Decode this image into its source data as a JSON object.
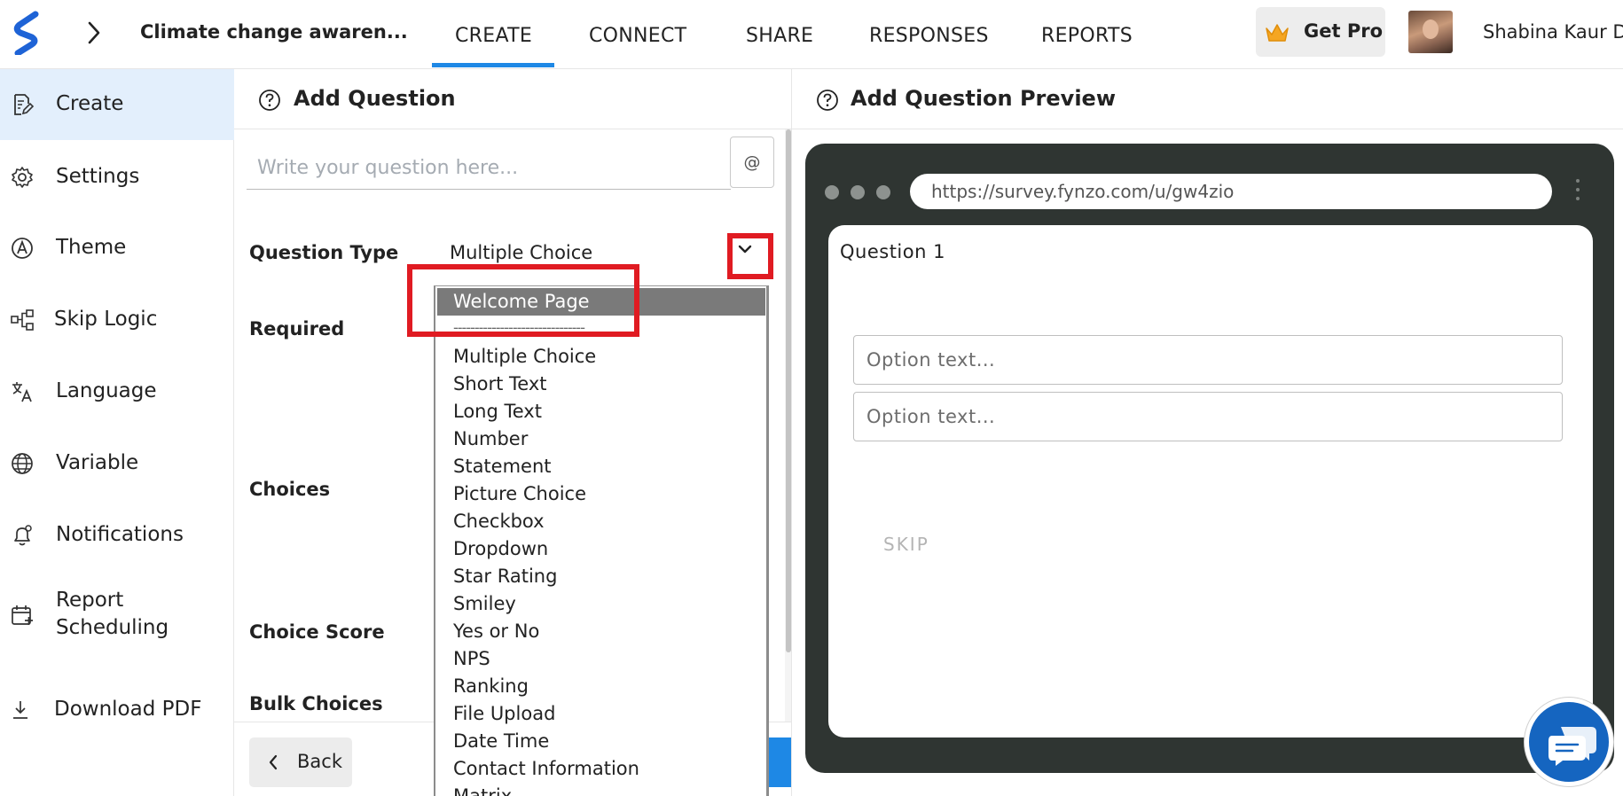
{
  "header": {
    "survey_title": "Climate change awaren...",
    "tabs": [
      {
        "label": "CREATE",
        "active": true
      },
      {
        "label": "CONNECT",
        "active": false
      },
      {
        "label": "SHARE",
        "active": false
      },
      {
        "label": "RESPONSES",
        "active": false
      },
      {
        "label": "REPORTS",
        "active": false
      }
    ],
    "get_pro_label": "Get Pro",
    "username": "Shabina Kaur D",
    "accent_color": "#1e88e5"
  },
  "sidebar": {
    "items": [
      {
        "label": "Create",
        "icon": "edit-document-icon",
        "active": true
      },
      {
        "label": "Settings",
        "icon": "gear-icon",
        "active": false
      },
      {
        "label": "Theme",
        "icon": "palette-icon",
        "active": false
      },
      {
        "label": "Skip Logic",
        "icon": "flow-icon",
        "active": false
      },
      {
        "label": "Language",
        "icon": "translate-icon",
        "active": false
      },
      {
        "label": "Variable",
        "icon": "globe-icon",
        "active": false
      },
      {
        "label": "Notifications",
        "icon": "bell-icon",
        "active": false
      },
      {
        "label": "Report",
        "label2": "Scheduling",
        "icon": "calendar-icon",
        "active": false
      },
      {
        "label": "Download PDF",
        "icon": "download-icon",
        "active": false
      }
    ]
  },
  "editor": {
    "title": "Add Question",
    "question_placeholder": "Write your question here...",
    "at_button": "@",
    "labels": {
      "question_type": "Question Type",
      "required": "Required",
      "choices": "Choices",
      "choice_score": "Choice Score",
      "bulk_choices": "Bulk Choices"
    },
    "question_type_value": "Multiple Choice",
    "back_label": "Back"
  },
  "dropdown": {
    "selected": "Welcome Page",
    "separator": "-------------------------------",
    "options": [
      "Multiple Choice",
      "Short Text",
      "Long Text",
      "Number",
      "Statement",
      "Picture Choice",
      "Checkbox",
      "Dropdown",
      "Star Rating",
      "Smiley",
      "Yes or No",
      "NPS",
      "Ranking",
      "File Upload",
      "Date Time",
      "Contact Information",
      "Matrix"
    ]
  },
  "preview": {
    "title": "Add Question Preview",
    "url": "https://survey.fynzo.com/u/gw4zio",
    "question_label": "Question 1",
    "option_placeholder_1": "Option text...",
    "option_placeholder_2": "Option text...",
    "skip_label": "SKIP"
  },
  "colors": {
    "highlight_box": "#e01b22",
    "browser_frame": "#2f3532",
    "chat_bubble": "#1565c0"
  }
}
